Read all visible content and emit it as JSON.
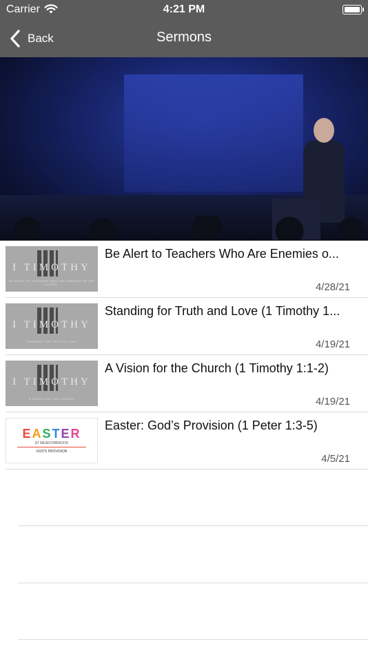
{
  "status_bar": {
    "carrier": "Carrier",
    "time": "4:21 PM"
  },
  "nav": {
    "back_label": "Back",
    "title": "Sermons"
  },
  "sermons": [
    {
      "title": "Be Alert to Teachers Who Are Enemies o...",
      "date": "4/28/21",
      "thumb": {
        "kind": "timothy",
        "title": "I TIMOTHY",
        "subtitle": "BE ALERT TO TEACHERS WHO ARE ENEMIES OF THE GOSPEL"
      }
    },
    {
      "title": "Standing for Truth and Love (1 Timothy 1...",
      "date": "4/19/21",
      "thumb": {
        "kind": "timothy",
        "title": "I TIMOTHY",
        "subtitle": "STANDING FOR TRUTH & LOVE"
      }
    },
    {
      "title": "A Vision for the Church (1 Timothy 1:1-2)",
      "date": "4/19/21",
      "thumb": {
        "kind": "timothy",
        "title": "I TIMOTHY",
        "subtitle": "A VISION FOR THE CHURCH"
      }
    },
    {
      "title": "Easter: God’s Provision (1 Peter 1:3-5)",
      "date": "4/5/21",
      "thumb": {
        "kind": "easter",
        "title_letters": [
          "E",
          "A",
          "S",
          "T",
          "E",
          "R"
        ],
        "at": "AT MEADOWBROOK",
        "subtitle": "GOD'S PROVISION"
      }
    }
  ]
}
